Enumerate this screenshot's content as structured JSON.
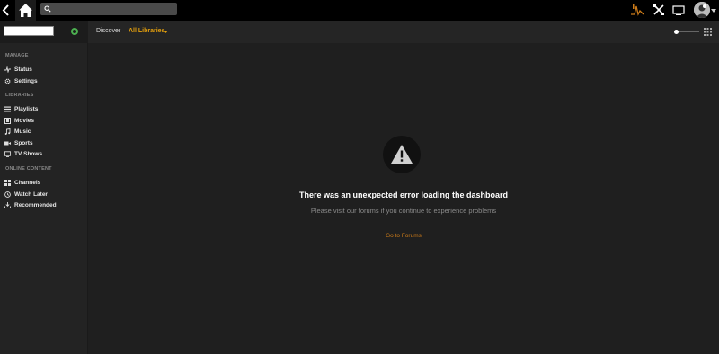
{
  "search": {
    "placeholder": ""
  },
  "server": {
    "status_color": "#4caf50"
  },
  "sidebar": {
    "sections": {
      "manage": "MANAGE",
      "libraries": "LIBRARIES",
      "online": "ONLINE CONTENT"
    },
    "manage": [
      {
        "label": "Status",
        "icon": "activity-icon"
      },
      {
        "label": "Settings",
        "icon": "gear-icon"
      }
    ],
    "libraries": [
      {
        "label": "Playlists",
        "icon": "playlist-icon"
      },
      {
        "label": "Movies",
        "icon": "film-icon"
      },
      {
        "label": "Music",
        "icon": "music-note-icon"
      },
      {
        "label": "Sports",
        "icon": "video-camera-icon"
      },
      {
        "label": "TV Shows",
        "icon": "tv-icon"
      }
    ],
    "online": [
      {
        "label": "Channels",
        "icon": "grid-icon"
      },
      {
        "label": "Watch Later",
        "icon": "clock-icon"
      },
      {
        "label": "Recommended",
        "icon": "download-icon"
      }
    ]
  },
  "breadcrumb": {
    "discover": "Discover",
    "separator": "—",
    "library": "All Libraries"
  },
  "error": {
    "title": "There was an unexpected error loading the dashboard",
    "subtitle": "Please visit our forums if you continue to experience problems",
    "link": "Go to Forums"
  },
  "colors": {
    "accent": "#e5a00d",
    "link": "#cc7b19",
    "background": "#1f1f1f",
    "topbar": "#000000"
  }
}
